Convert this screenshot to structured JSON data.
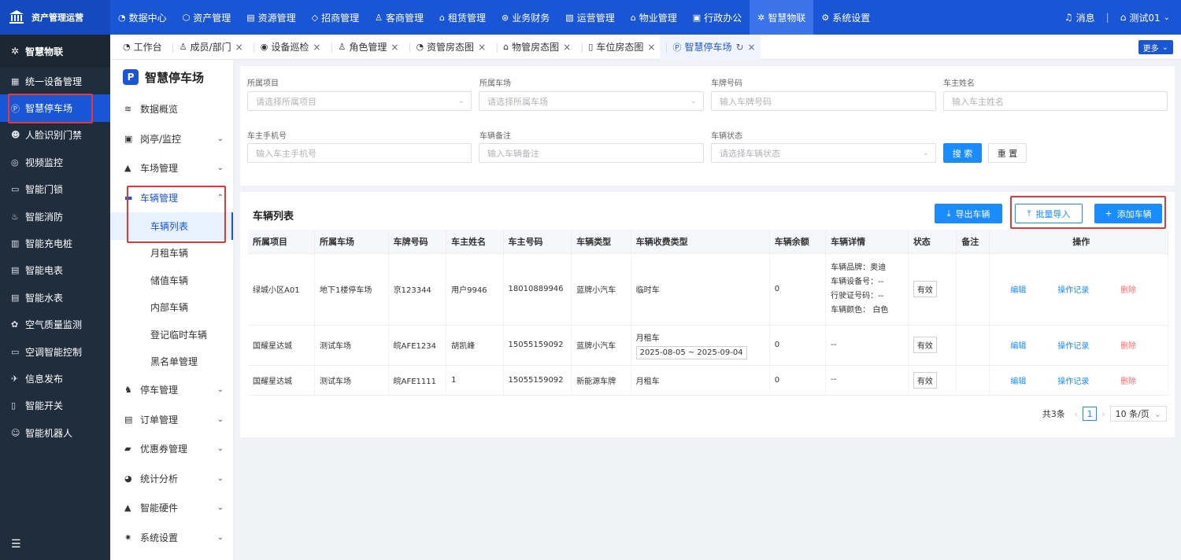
{
  "topbar": {
    "brand": "资产管理运营",
    "nav": [
      {
        "icon": "◔",
        "label": "数据中心"
      },
      {
        "icon": "⬡",
        "label": "资产管理"
      },
      {
        "icon": "▤",
        "label": "资源管理"
      },
      {
        "icon": "◇",
        "label": "招商管理"
      },
      {
        "icon": "♙",
        "label": "客商管理"
      },
      {
        "icon": "⌂",
        "label": "租赁管理"
      },
      {
        "icon": "⊛",
        "label": "业务财务"
      },
      {
        "icon": "▧",
        "label": "运营管理"
      },
      {
        "icon": "⌂",
        "label": "物业管理"
      },
      {
        "icon": "▣",
        "label": "行政办公"
      },
      {
        "icon": "✲",
        "label": "智慧物联"
      },
      {
        "icon": "⚙",
        "label": "系统设置"
      }
    ],
    "messages": "消息",
    "user": "测试01"
  },
  "leftnav": {
    "header": "智慧物联",
    "items": [
      {
        "icon": "▦",
        "label": "统一设备管理"
      },
      {
        "icon": "Ⓟ",
        "label": "智慧停车场"
      },
      {
        "icon": "☻",
        "label": "人脸识别门禁"
      },
      {
        "icon": "◎",
        "label": "视频监控"
      },
      {
        "icon": "▭",
        "label": "智能门锁"
      },
      {
        "icon": "♨",
        "label": "智能消防"
      },
      {
        "icon": "▥",
        "label": "智能充电桩"
      },
      {
        "icon": "▤",
        "label": "智能电表"
      },
      {
        "icon": "▤",
        "label": "智能水表"
      },
      {
        "icon": "✿",
        "label": "空气质量监测"
      },
      {
        "icon": "▭",
        "label": "空调智能控制"
      },
      {
        "icon": "✈",
        "label": "信息发布"
      },
      {
        "icon": "▯",
        "label": "智能开关"
      },
      {
        "icon": "☺",
        "label": "智能机器人"
      }
    ]
  },
  "tabs": [
    {
      "icon": "◔",
      "label": "工作台",
      "closable": false
    },
    {
      "icon": "♙",
      "label": "成员/部门",
      "closable": true
    },
    {
      "icon": "◉",
      "label": "设备巡检",
      "closable": true
    },
    {
      "icon": "♙",
      "label": "角色管理",
      "closable": true
    },
    {
      "icon": "◔",
      "label": "资管房态图",
      "closable": true
    },
    {
      "icon": "⌂",
      "label": "物管房态图",
      "closable": true
    },
    {
      "icon": "▯",
      "label": "车位房态图",
      "closable": true
    },
    {
      "icon": "Ⓟ",
      "label": "智慧停车场",
      "closable": true
    }
  ],
  "more": "更多",
  "subnav": {
    "title": "智慧停车场",
    "groups_top": [
      {
        "icon": "≋",
        "label": "数据概览",
        "chev": ""
      },
      {
        "icon": "▣",
        "label": "岗亭/监控",
        "chev": "⌄"
      },
      {
        "icon": "▲",
        "label": "车场管理",
        "chev": "⌄"
      }
    ],
    "open_group": {
      "icon": "▬",
      "label": "车辆管理",
      "chev": "⌃"
    },
    "subs": [
      "车辆列表",
      "月租车辆",
      "储值车辆",
      "内部车辆",
      "登记临时车辆",
      "黑名单管理"
    ],
    "groups_bottom": [
      {
        "icon": "♞",
        "label": "停车管理",
        "chev": "⌄"
      },
      {
        "icon": "▤",
        "label": "订单管理",
        "chev": "⌄"
      },
      {
        "icon": "▰",
        "label": "优惠券管理",
        "chev": "⌄"
      },
      {
        "icon": "◕",
        "label": "统计分析",
        "chev": "⌄"
      },
      {
        "icon": "▲",
        "label": "智能硬件",
        "chev": "⌄"
      },
      {
        "icon": "✷",
        "label": "系统设置",
        "chev": "⌄"
      }
    ]
  },
  "filter": {
    "project": {
      "label": "所属项目",
      "placeholder": "请选择所属项目"
    },
    "lot": {
      "label": "所属车场",
      "placeholder": "请选择所属车场"
    },
    "plate": {
      "label": "车牌号码",
      "placeholder": "输入车牌号码"
    },
    "owner": {
      "label": "车主姓名",
      "placeholder": "输入车主姓名"
    },
    "phone": {
      "label": "车主手机号",
      "placeholder": "输入车主手机号"
    },
    "remark": {
      "label": "车辆备注",
      "placeholder": "输入车辆备注"
    },
    "status": {
      "label": "车辆状态",
      "placeholder": "请选择车辆状态"
    },
    "search": "搜 索",
    "reset": "重 置"
  },
  "list": {
    "title": "车辆列表",
    "export": "导出车辆",
    "import": "批量导入",
    "add": "添加车辆",
    "columns": [
      "所属项目",
      "所属车场",
      "车牌号码",
      "车主姓名",
      "车主号码",
      "车辆类型",
      "车辆收费类型",
      "车辆余额",
      "车辆详情",
      "状态",
      "备注",
      "操作"
    ],
    "rows": [
      {
        "project": "绿城小区A01",
        "lot": "地下1楼停车场",
        "plate": "京123344",
        "owner": "用户9946",
        "phone": "18010889946",
        "type": "蓝牌小汽车",
        "fee": "临时车",
        "fee_range": "",
        "balance": "0",
        "details": [
          "车辆品牌：奥迪",
          "车辆设备号：--",
          "行驶证号码：--",
          "车辆颜色： 白色"
        ],
        "status": "有效",
        "remark": ""
      },
      {
        "project": "国耀星达城",
        "lot": "测试车场",
        "plate": "皖AFE1234",
        "owner": "胡凯峰",
        "phone": "15055159092",
        "type": "蓝牌小汽车",
        "fee": "月租车",
        "fee_range": "2025-08-05 ~ 2025-09-04",
        "balance": "0",
        "details": [
          "--"
        ],
        "status": "有效",
        "remark": ""
      },
      {
        "project": "国耀星达城",
        "lot": "测试车场",
        "plate": "皖AFE1111",
        "owner": "1",
        "phone": "15055159092",
        "type": "新能源车牌",
        "fee": "月租车",
        "fee_range": "",
        "balance": "0",
        "details": [
          "--"
        ],
        "status": "有效",
        "remark": ""
      }
    ],
    "ops": {
      "edit": "编辑",
      "log": "操作记录",
      "delete": "删除"
    }
  },
  "pager": {
    "total": "共3条",
    "page": "1",
    "size": "10 条/页"
  },
  "colors": {
    "primary": "#1a55d6",
    "button": "#1a8cff",
    "danger": "#f56c6c",
    "highlight": "#e53935"
  }
}
